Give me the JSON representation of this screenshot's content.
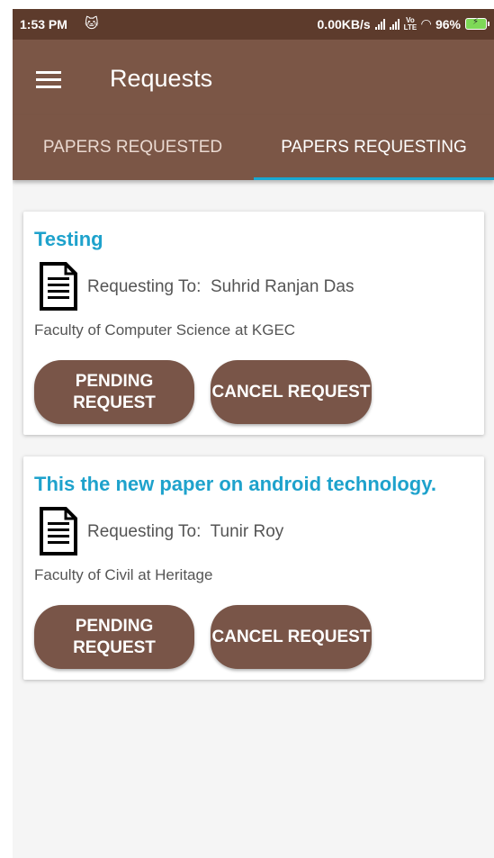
{
  "status_bar": {
    "time": "1:53 PM",
    "speed": "0.00KB/s",
    "network_label": "Vo​LTE",
    "battery": "96%"
  },
  "toolbar": {
    "title": "Requests"
  },
  "tabs": [
    {
      "label": "PAPERS REQUESTED",
      "active": false
    },
    {
      "label": "PAPERS REQUESTING",
      "active": true
    }
  ],
  "requests": [
    {
      "title": "Testing",
      "requesting_to_label": "Requesting To:",
      "requesting_to": "Suhrid Ranjan Das",
      "faculty": "Faculty of Computer Science at KGEC",
      "pending_label": "PENDING\nREQUEST",
      "cancel_label": "CANCEL REQUEST"
    },
    {
      "title": "This the new paper on android technology.",
      "requesting_to_label": "Requesting To:",
      "requesting_to": "Tunir Roy",
      "faculty": "Faculty of Civil at Heritage",
      "pending_label": "PENDING\nREQUEST",
      "cancel_label": "CANCEL REQUEST"
    }
  ],
  "colors": {
    "appbar": "#7b5646",
    "statusbar": "#5d3b2c",
    "accent": "#18a8d2",
    "button": "#795548"
  }
}
